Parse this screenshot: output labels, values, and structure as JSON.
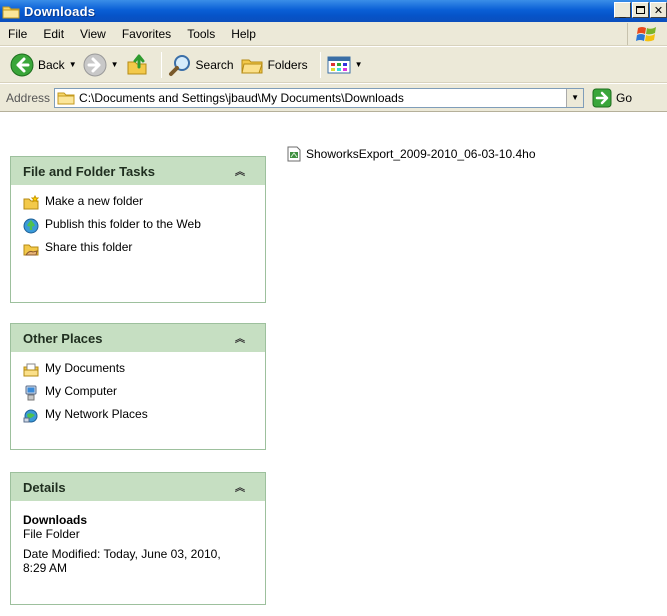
{
  "window": {
    "title": "Downloads"
  },
  "menubar": {
    "items": [
      "File",
      "Edit",
      "View",
      "Favorites",
      "Tools",
      "Help"
    ]
  },
  "toolbar": {
    "back_label": "Back",
    "search_label": "Search",
    "folders_label": "Folders"
  },
  "address": {
    "label": "Address",
    "path": "C:\\Documents and Settings\\jbaud\\My Documents\\Downloads",
    "go_label": "Go"
  },
  "panels": {
    "file_tasks": {
      "title": "File and Folder Tasks",
      "items": [
        "Make a new folder",
        "Publish this folder to the Web",
        "Share this folder"
      ]
    },
    "other_places": {
      "title": "Other Places",
      "items": [
        "My Documents",
        "My Computer",
        "My Network Places"
      ]
    },
    "details": {
      "title": "Details",
      "name": "Downloads",
      "type": "File Folder",
      "modified": "Date Modified: Today, June 03, 2010, 8:29 AM"
    }
  },
  "files": [
    {
      "name": "ShoworksExport_2009-2010_06-03-10.4ho"
    }
  ]
}
